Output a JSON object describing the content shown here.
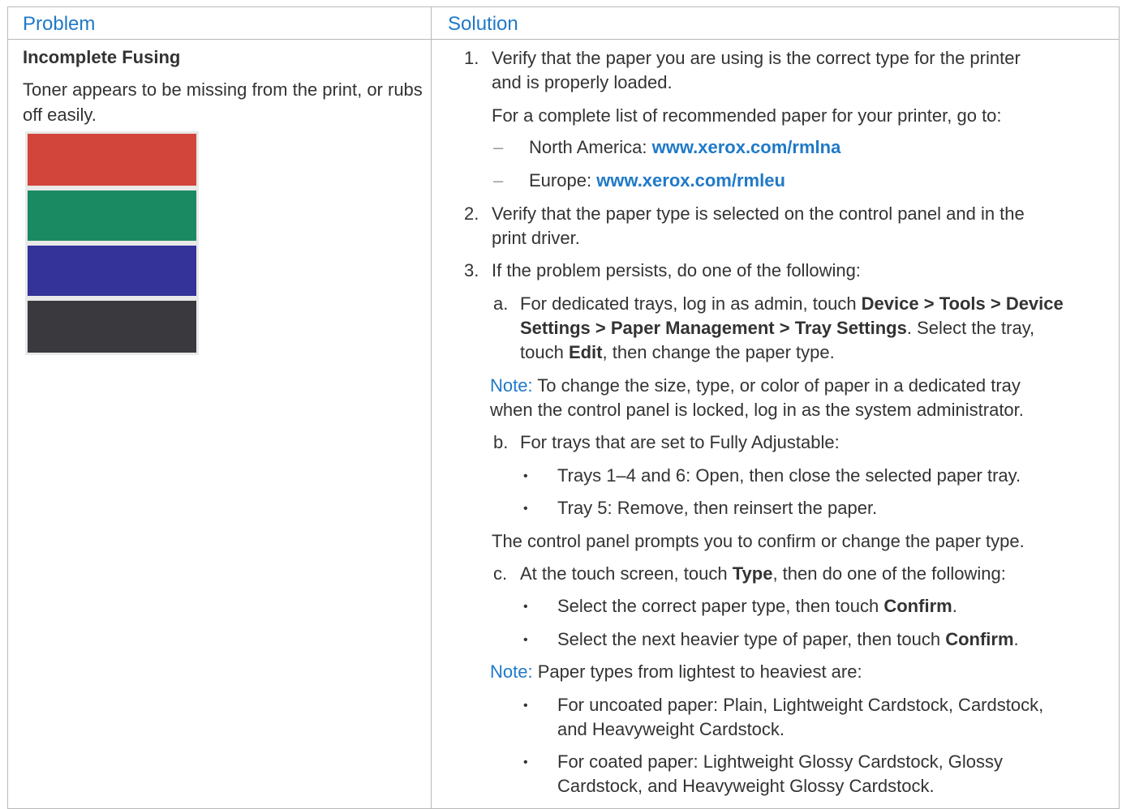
{
  "header": {
    "problem": "Problem",
    "solution": "Solution"
  },
  "problem": {
    "title": "Incomplete Fusing",
    "description": "Toner appears to be missing from the print, or rubs off easily."
  },
  "sample_image": {
    "colors": [
      "#d2453a",
      "#1a8a62",
      "#33339a",
      "#3a3a3e"
    ]
  },
  "steps": {
    "s1_num": "1.",
    "s1_l1": "Verify that the paper you are using is the correct type for the printer",
    "s1_l2": "and is properly loaded.",
    "s1_list_intro": "For a complete list of recommended paper for your printer, go to:",
    "dash": "–",
    "na_label": "North America: ",
    "na_link": "www.xerox.com/rmlna",
    "eu_label": "Europe: ",
    "eu_link": "www.xerox.com/rmleu",
    "s2_num": "2.",
    "s2_l1": "Verify that the paper type is selected on the control panel and in the",
    "s2_l2": "print driver.",
    "s3_num": "3.",
    "s3_l1": "If the problem persists, do one of the following:",
    "a_label": "a.",
    "a_p1": "For dedicated trays, log in as admin, touch ",
    "a_device": "Device",
    "a_sep1": " > ",
    "a_tools": "Tools",
    "a_sep2": " > ",
    "a_device2": "Device",
    "a_settings": "Settings",
    "a_sep3": " > ",
    "a_paper_mgmt": "Paper Management",
    "a_sep4": " > ",
    "a_tray_settings": "Tray Settings",
    "a_p2": ". Select the tray,",
    "a_p3": "touch ",
    "a_edit": "Edit",
    "a_p4": ", then change the paper type.",
    "note_label": "Note:",
    "note1_l1": " To change the size, type, or color of paper in a dedicated tray",
    "note1_l2": "when the control panel is locked, log in as the system administrator.",
    "b_label": "b.",
    "b_l1": "For trays that are set to Fully Adjustable:",
    "bullet": "•",
    "b_bul1": "Trays 1–4 and 6: Open, then close the selected paper tray.",
    "b_bul2": "Tray 5: Remove, then reinsert the paper.",
    "b_after": "The control panel prompts you to confirm or change the paper type.",
    "c_label": "c.",
    "c_p1": "At the touch screen, touch ",
    "c_type": "Type",
    "c_p2": ", then do one of the following:",
    "c_bul1_p1": "Select the correct paper type, then touch ",
    "c_confirm": "Confirm",
    "c_period": ".",
    "c_bul2_p1": "Select the next heavier type of paper, then touch ",
    "note2_text": " Paper types from lightest to heaviest are:",
    "n2_bul1_l1": "For uncoated paper: Plain, Lightweight Cardstock, Cardstock,",
    "n2_bul1_l2": "and Heavyweight Cardstock.",
    "n2_bul2_l1": "For coated paper: Lightweight Glossy Cardstock, Glossy",
    "n2_bul2_l2": "Cardstock, and Heavyweight Glossy Cardstock."
  }
}
